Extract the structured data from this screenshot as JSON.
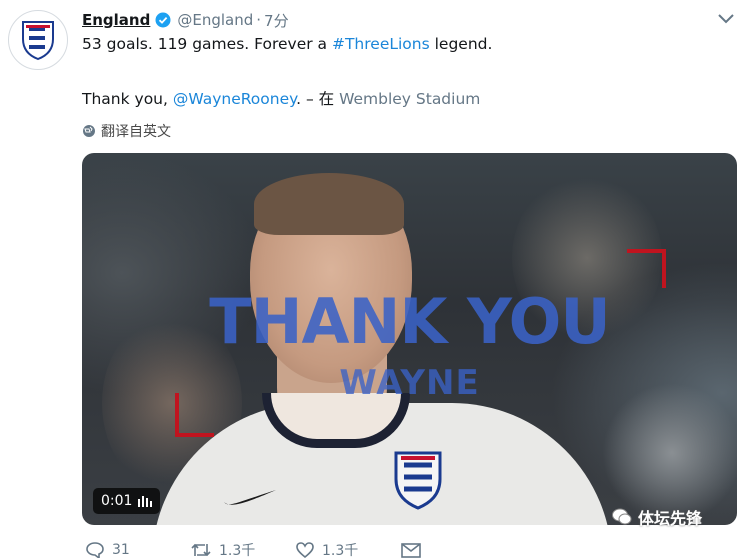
{
  "tweet": {
    "author_name": "England",
    "handle": "@England",
    "separator": "·",
    "time": "7分",
    "line1": {
      "text": "53 goals. 119 games. Forever a ",
      "hashtag": "#ThreeLions",
      "after": " legend."
    },
    "line2": {
      "before": "Thank you, ",
      "mention": "@WayneRooney",
      "after": ". – 在 ",
      "location": "Wembley Stadium"
    },
    "translate_label": "翻译自英文"
  },
  "media": {
    "overlay_title": "THANK YOU",
    "overlay_subtitle": "WAYNE",
    "timestamp": "0:01"
  },
  "actions": {
    "reply_count": "31",
    "retweet_count": "1.3千",
    "like_count": "1.3千"
  },
  "watermark": {
    "text": "体坛先锋"
  },
  "colors": {
    "link": "#1b86d9",
    "verified": "#1da1f2",
    "overlay": "#3a62c6",
    "bracket": "#c0141f"
  }
}
